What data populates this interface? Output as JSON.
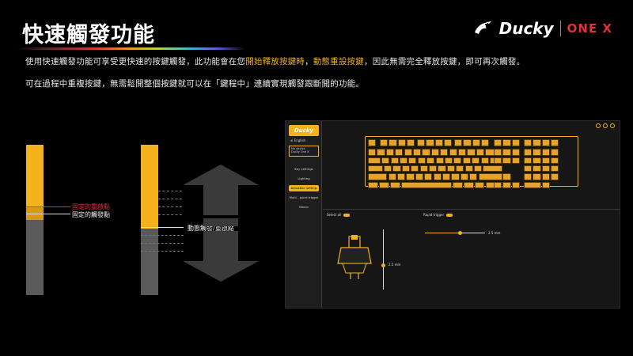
{
  "header": {
    "title": "快速觸發功能",
    "logo_brand": "Ducky",
    "logo_product": "ONE X"
  },
  "description": {
    "line1_a": "使用快速觸發功能可享受更快速的按鍵觸發，此功能會在您",
    "line1_hl1": "開始釋放按鍵時",
    "line1_b": "，",
    "line1_hl2": "動態重設按鍵",
    "line1_c": "，因此無需完全釋放按鍵，即可再次觸發。",
    "line2": "可在過程中重複按鍵，無需鬆開整個按鍵就可以在「鍵程中」連續實現觸發跟斷開的功能。"
  },
  "illustration": {
    "fixed_reset_label": "固定的重啟點",
    "fixed_trigger_label": "固定的觸發點",
    "dynamic_label": "動態觸發/重啟點"
  },
  "app": {
    "brand": "Ducky",
    "language": "English",
    "device_header": "My device",
    "device_name": "Ducky One X",
    "menu": [
      {
        "label": "Key settings",
        "active": false
      },
      {
        "label": "Lighting",
        "active": false
      },
      {
        "label": "Actuation setting",
        "active": true
      },
      {
        "label": "Multi - point trigger",
        "active": false
      },
      {
        "label": "Macro",
        "active": false
      }
    ],
    "select_all_label": "Select all",
    "rapid_trigger_label": "Rapid trigger",
    "actuation_value": "2.5 mm",
    "rapid_value": "2.5 mm"
  },
  "colors": {
    "accent": "#f3b21b",
    "key_gray": "#5a5a5a",
    "reset_red": "#e0313b"
  }
}
